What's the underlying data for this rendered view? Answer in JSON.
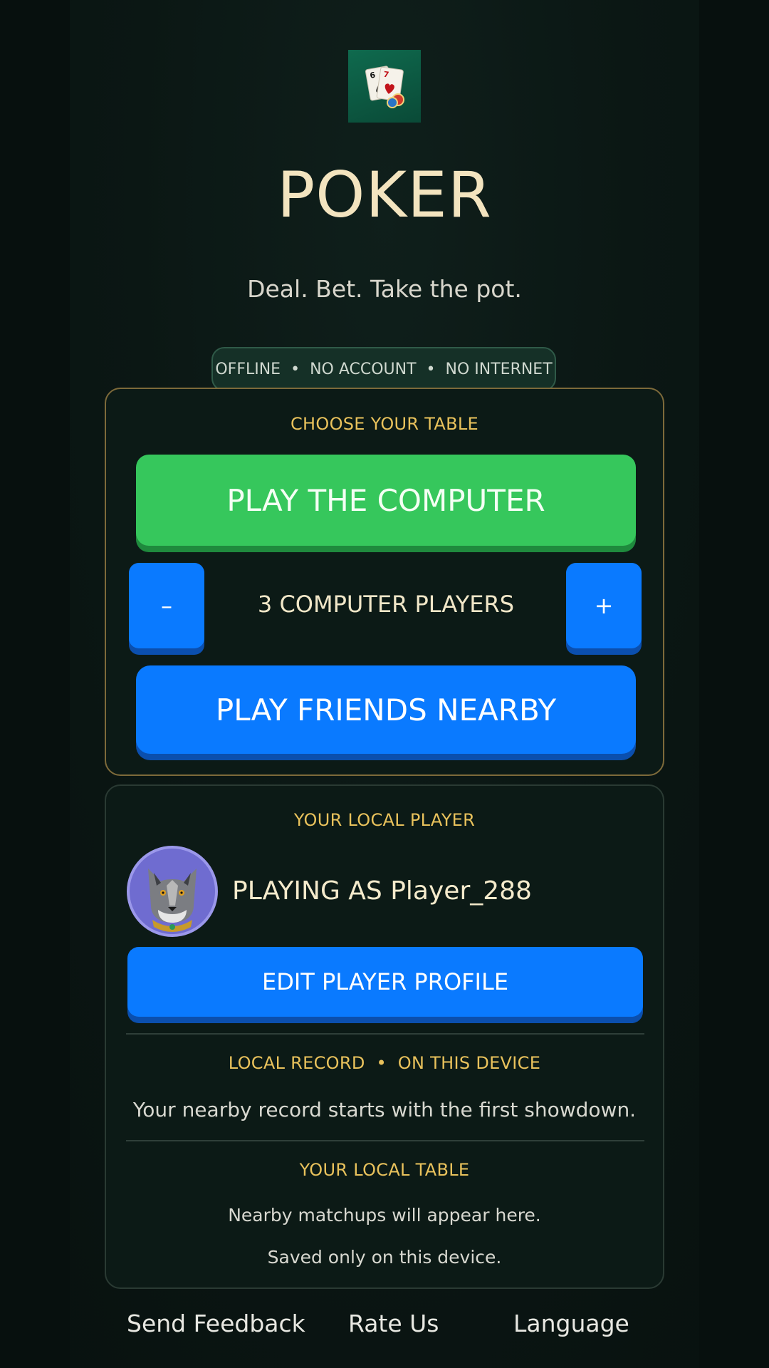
{
  "app": {
    "title": "POKER",
    "tagline": "Deal. Bet. Take the pot.",
    "logo_icon": "playing-cards-with-chips-icon"
  },
  "mode_pill": {
    "items": [
      "OFFLINE",
      "NO ACCOUNT",
      "NO INTERNET"
    ],
    "separator": "•"
  },
  "table_card": {
    "label": "CHOOSE YOUR TABLE",
    "play_computer_label": "PLAY THE COMPUTER",
    "decrement_label": "–",
    "increment_label": "+",
    "computer_players_label": "3 COMPUTER PLAYERS",
    "play_friends_label": "PLAY FRIENDS NEARBY"
  },
  "player_card": {
    "label": "YOUR LOCAL PLAYER",
    "avatar_icon": "wolf-avatar-icon",
    "playing_as": "PLAYING AS Player_288",
    "edit_profile_label": "EDIT PLAYER PROFILE",
    "record_label": "LOCAL RECORD  •  ON THIS DEVICE",
    "record_text": "Your nearby record starts with the first showdown.",
    "table_label": "YOUR LOCAL TABLE",
    "table_text_1": "Nearby matchups will appear here.",
    "table_text_2": "Saved only on this device."
  },
  "footer": {
    "feedback": "Send Feedback",
    "rate": "Rate Us",
    "language": "Language"
  },
  "colors": {
    "accent_gold": "#e9c25c",
    "green_button": "#36c75c",
    "blue_button": "#0a7aff",
    "background": "#0b1714"
  }
}
